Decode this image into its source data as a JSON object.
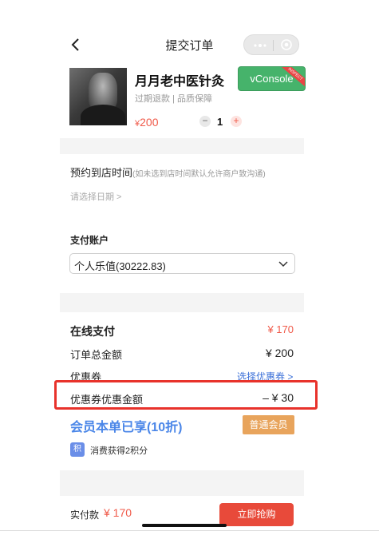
{
  "header": {
    "title": "提交订单"
  },
  "product": {
    "name": "月月老中医针灸",
    "tags": "过期退款 | 品质保障",
    "price_symbol": "¥",
    "price": "200",
    "quantity": "1",
    "minus": "−",
    "plus": "+"
  },
  "vconsole": {
    "label": "vConsole",
    "ribbon": "INSPECT"
  },
  "appointment": {
    "title": "预约到店时间",
    "hint": "(如未选到店时间默认允许商户致沟通)",
    "date_placeholder": "请选择日期 >"
  },
  "account": {
    "label": "支付账户",
    "selected": "个人乐值(30222.83)"
  },
  "summary": {
    "online_label": "在线支付",
    "online_value": "¥ 170",
    "total_label": "订单总金额",
    "total_value": "¥ 200",
    "coupon_label": "优惠券",
    "coupon_link": "选择优惠券 >",
    "discount_label": "优惠券优惠金额",
    "discount_value": "– ¥ 30"
  },
  "member": {
    "text": "会员本单已享(10折)",
    "badge": "普通会员",
    "points_icon": "积",
    "points_text": "消费获得2积分"
  },
  "footer": {
    "pay_label": "实付款",
    "pay_amount": "¥ 170",
    "buy_button": "立即抢购"
  },
  "colors": {
    "accent_red": "#f05a4a",
    "member_blue": "#4a86e8",
    "badge_orange": "#e8a45c",
    "highlight": "#e8322b",
    "vconsole_green": "#46b36b"
  }
}
